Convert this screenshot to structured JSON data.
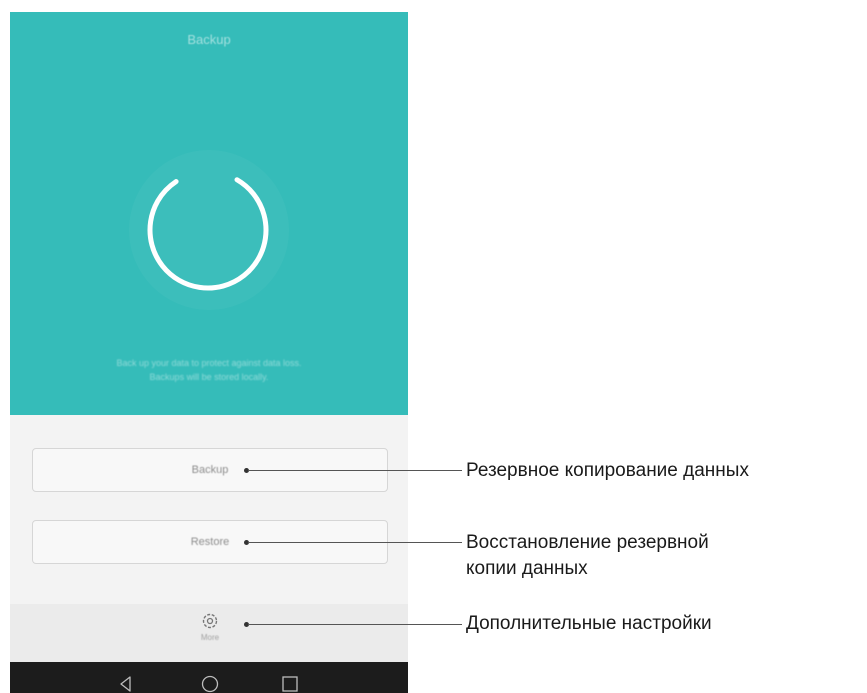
{
  "screen": {
    "title": "Backup",
    "description_line1": "Back up your data to protect against data loss.",
    "description_line2": "Backups will be stored locally."
  },
  "buttons": {
    "backup_label": "Backup",
    "restore_label": "Restore",
    "more_label": "More"
  },
  "icons": {
    "spinner": "loading-ring-icon",
    "more": "gear-icon",
    "nav_back": "back-triangle-icon",
    "nav_home": "home-circle-icon",
    "nav_recent": "recent-square-icon"
  },
  "callouts": {
    "backup": "Резервное копирование данных",
    "restore_line1": "Восстановление резервной",
    "restore_line2": "копии данных",
    "more": "Дополнительные настройки"
  },
  "colors": {
    "accent": "#35bcb9",
    "background": "#f3f3f3",
    "navbar": "#1c1c1c"
  }
}
